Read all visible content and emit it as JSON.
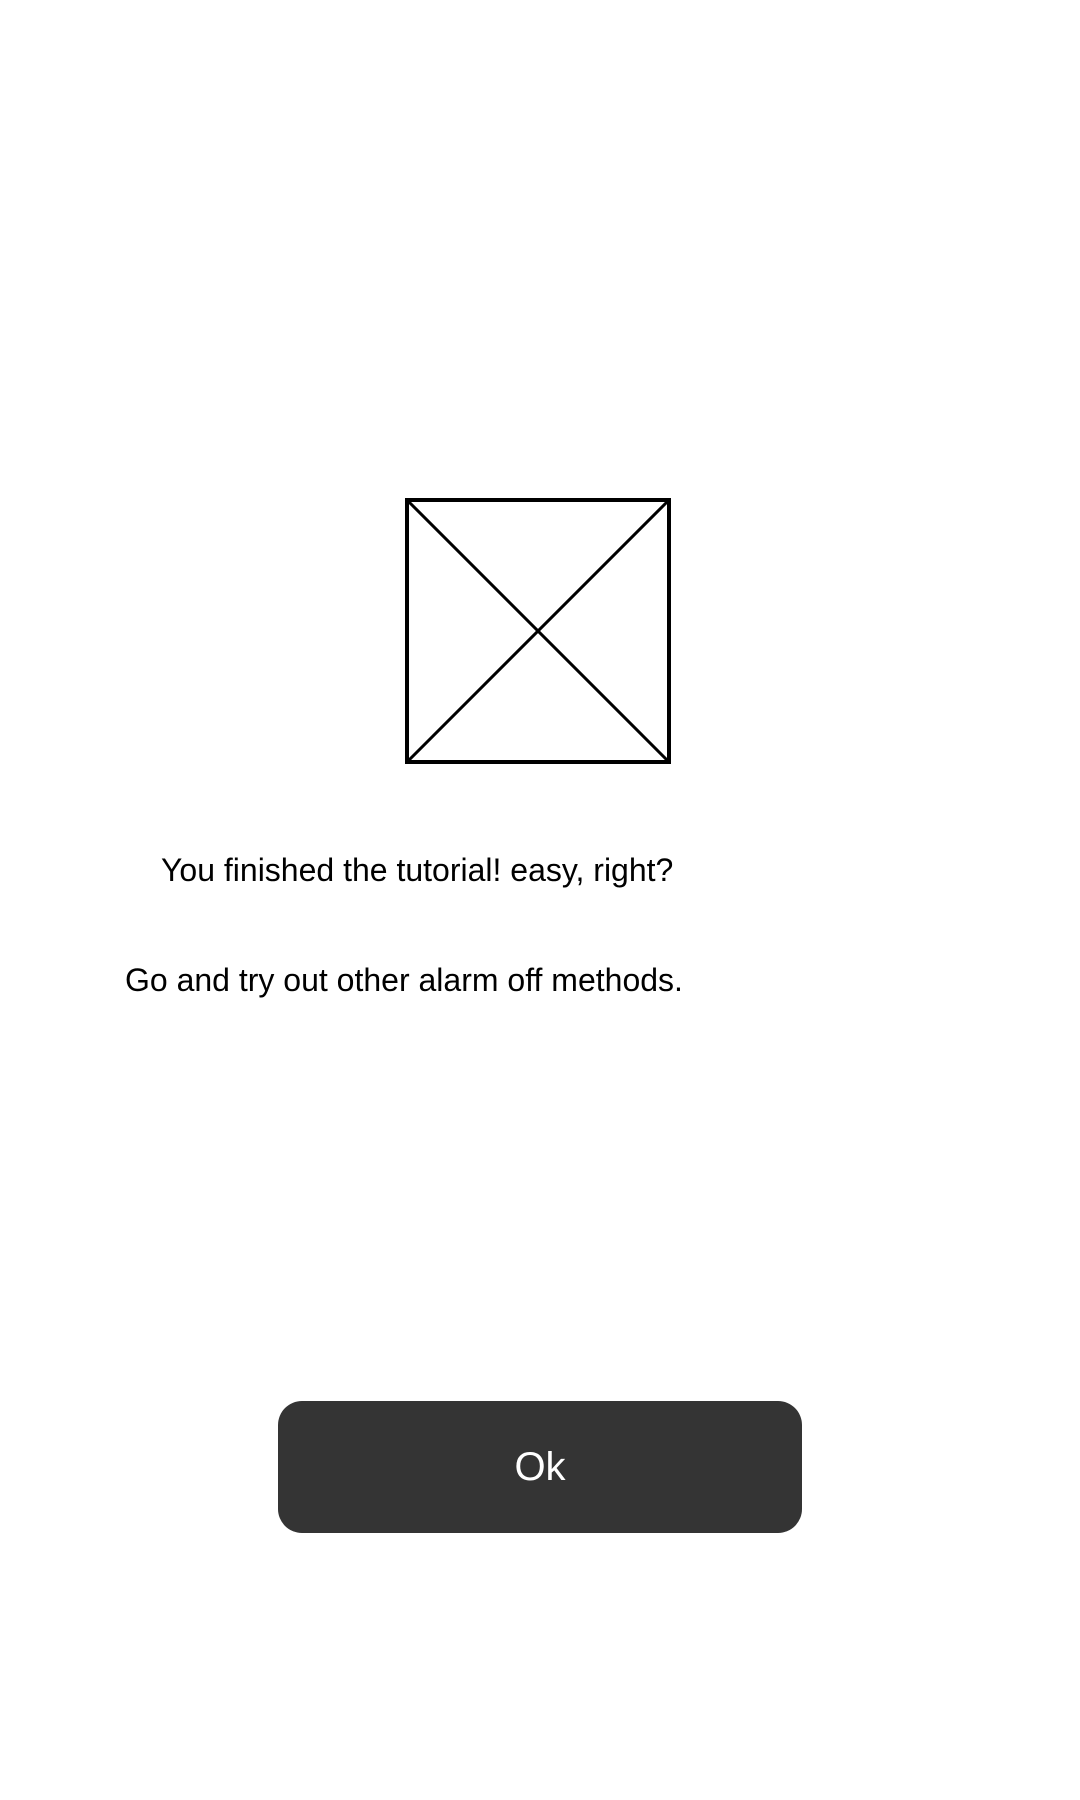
{
  "tutorial": {
    "image_icon": "broken-image-placeholder-icon",
    "message_line_1": "You finished the tutorial! easy, right?",
    "message_line_2": "Go and try out other alarm off methods."
  },
  "actions": {
    "ok_label": "Ok"
  },
  "colors": {
    "background": "#ffffff",
    "text": "#000000",
    "button_background": "#343434",
    "button_text": "#ffffff"
  }
}
